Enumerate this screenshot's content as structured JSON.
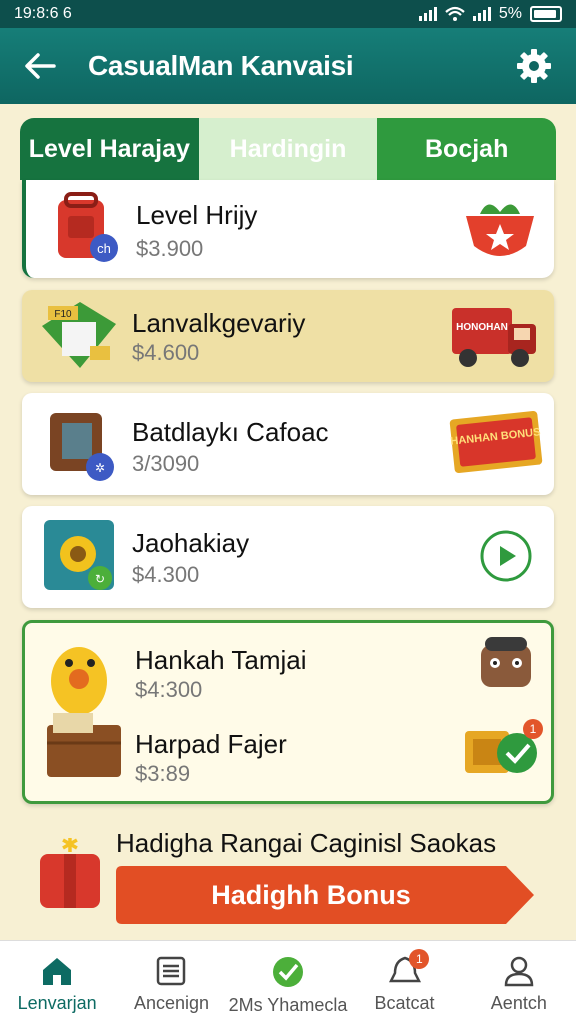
{
  "status_bar": {
    "time": "19:8:6 6",
    "battery": "5%"
  },
  "app_bar": {
    "title": "CasualMan Kanvaisi",
    "back_icon": "arrow-left-icon",
    "settings_icon": "gear-icon"
  },
  "tabs": [
    {
      "label": "Level Harajay"
    },
    {
      "label": "Hardingin"
    },
    {
      "label": "Bocjah"
    }
  ],
  "items": [
    {
      "name": "Level Hrijy",
      "price": "$3.900"
    },
    {
      "name": "Lanvalkgevariy",
      "price": "$4.600"
    },
    {
      "name": "Batdlaykı Cafoac",
      "price": "3/3090"
    },
    {
      "name": "Jaohakiay",
      "price": "$4.300"
    },
    {
      "name": "Hankah Tamjai",
      "price": "$4:300"
    },
    {
      "name": "Harpad Fajer",
      "price": "$3:89"
    }
  ],
  "thumb_texts": {
    "truck": "HONOHAN",
    "ticket": "HANHAN BONUS",
    "badge_count": "1"
  },
  "bonus": {
    "title": "Hadigha Rangai Caginisl Saokas",
    "button_label": "Hadighh Bonus"
  },
  "bottom_nav": [
    {
      "label": "Lenvarjan",
      "icon": "home-icon"
    },
    {
      "label": "Ancenign",
      "icon": "list-icon"
    },
    {
      "label": "2Ms Yhamecla",
      "icon": "check-badge-icon"
    },
    {
      "label": "Bcatcat",
      "icon": "bell-icon",
      "badge": "1"
    },
    {
      "label": "Aentch",
      "icon": "person-icon"
    }
  ],
  "colors": {
    "primary": "#0e6661",
    "green": "#16733f",
    "accent": "#e24e24",
    "bg": "#f7f0d3"
  }
}
